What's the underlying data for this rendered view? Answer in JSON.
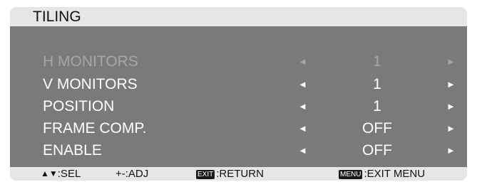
{
  "menu": {
    "title": "TILING",
    "arrows": {
      "left": "◄",
      "right": "►"
    },
    "rows": [
      {
        "label": "H MONITORS",
        "value": "1",
        "enabled": false
      },
      {
        "label": "V MONITORS",
        "value": "1",
        "enabled": true
      },
      {
        "label": "POSITION",
        "value": "1",
        "enabled": true
      },
      {
        "label": "FRAME COMP.",
        "value": "OFF",
        "enabled": true
      },
      {
        "label": "ENABLE",
        "value": "OFF",
        "enabled": true
      }
    ]
  },
  "help": {
    "sel_glyph": "▲▼",
    "sel_text": ":SEL",
    "adj_text": "+-:ADJ",
    "exit_key": "EXIT",
    "exit_text": ":RETURN",
    "menu_key": "MENU",
    "menu_text": ":EXIT MENU"
  },
  "colors": {
    "panel": "#7a7a7a",
    "bar": "#e6e6e6",
    "text_active": "#ffffff",
    "text_disabled": "#a6a6a6"
  }
}
